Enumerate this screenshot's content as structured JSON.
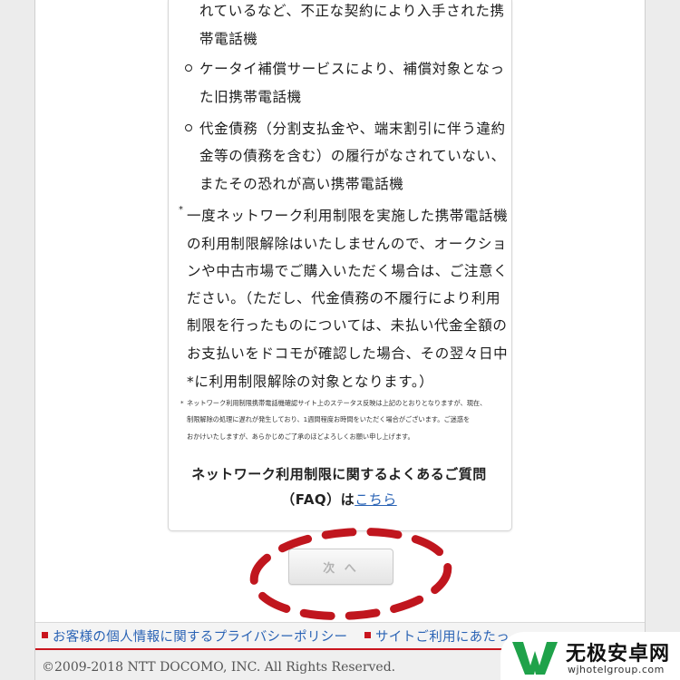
{
  "content": {
    "lines": [
      "れているなど、不正な契約により入手された携",
      "帯電話機",
      "ケータイ補償サービスにより、補償対象となっ",
      "た旧携帯電話機",
      "代金債務（分割支払金や、端末割引に伴う違約",
      "金等の債務を含む）の履行がなされていない、",
      "またその恐れが高い携帯電話機",
      "一度ネットワーク利用制限を実施した携帯電話機",
      "の利用制限解除はいたしませんので、オークショ",
      "ンや中古市場でご購入いただく場合は、ご注意く",
      "ださい。（ただし、代金債務の不履行により利用",
      "制限を行ったものについては、未払い代金全額の",
      "お支払いをドコモが確認した場合、その翌々日中",
      "*に利用制限解除の対象となります。）"
    ],
    "note_mark": "*",
    "small_note_mark": "*",
    "small_lines": [
      "ネットワーク利用制限携帯電話機確認サイト上のステータス反映は上記のとおりとなりますが、現在、",
      "制限解除の処理に遅れが発生しており、1週間程度お時間をいただく場合がございます。ご迷惑を",
      "おかけいたしますが、あらかじめご了承のほどよろしくお願い申し上げます。"
    ],
    "faq_line1": "ネットワーク利用制限に関するよくあるご質問",
    "faq_line2_prefix": "（FAQ）は",
    "faq_link": "こちら"
  },
  "next_button": {
    "label": "次 へ"
  },
  "footer": {
    "links": [
      "お客様の個人情報に関するプライバシーポリシー",
      "サイトご利用にあたっ"
    ],
    "copyright": "©2009-2018 NTT DOCOMO, INC. All Rights Reserved."
  },
  "watermark": {
    "title": "无极安卓网",
    "url": "wjhotelgroup.com"
  },
  "colors": {
    "accent_red": "#c9151e",
    "link_blue": "#2a63b5",
    "annotation_red": "#c0161e",
    "watermark_green": "#1fa24a"
  }
}
